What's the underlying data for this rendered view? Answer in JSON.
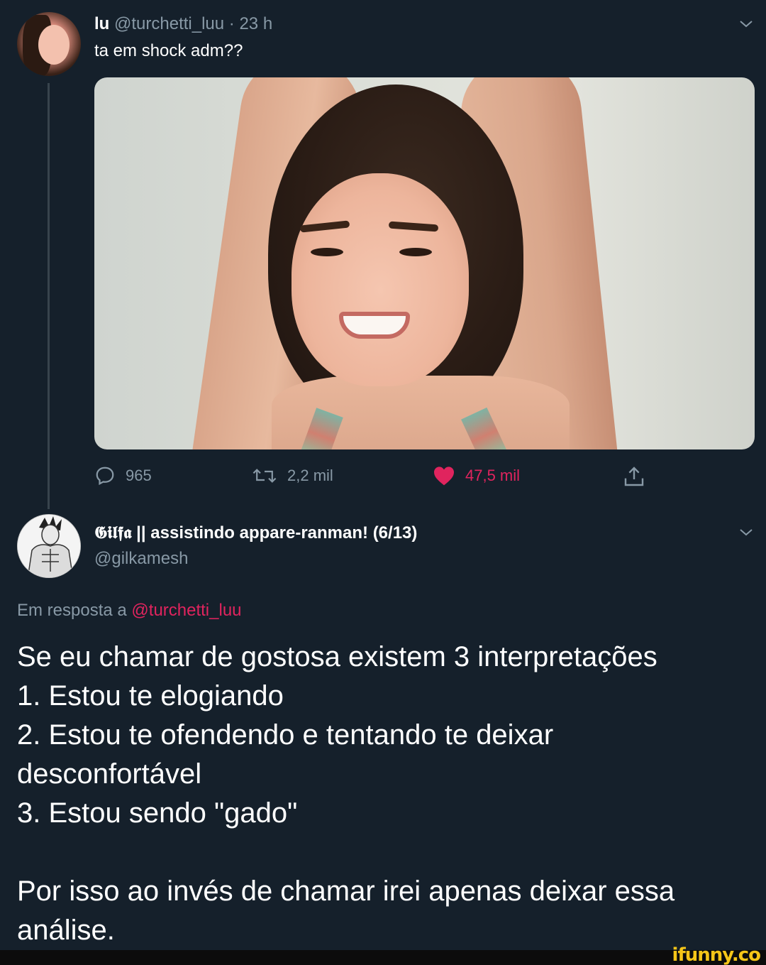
{
  "tweet1": {
    "name": "lu",
    "handle": "@turchetti_luu",
    "separator": "·",
    "time": "23 h",
    "text": "ta em shock adm??",
    "actions": {
      "replies": "965",
      "retweets": "2,2 mil",
      "likes": "47,5 mil"
    }
  },
  "tweet2": {
    "name_prefix": "𝕲𝖎𝖑𝖋𝖆",
    "name_rest": "|| assistindo appare-ranman! (6/13)",
    "handle": "@gilkamesh",
    "reply_label": "Em resposta a",
    "reply_to": "@turchetti_luu",
    "lines": [
      "Se eu chamar de gostosa existem 3 interpretações",
      "1. Estou te elogiando",
      "2. Estou te ofendendo e tentando te deixar",
      "desconfortável",
      "3. Estou sendo \"gado\""
    ],
    "closing": [
      "Por isso ao invés de chamar irei apenas deixar essa",
      "análise."
    ]
  },
  "watermark": "ifunny.co",
  "colors": {
    "background": "#15202b",
    "muted": "#8899a6",
    "like": "#e0245e",
    "watermark": "#f5c518"
  },
  "icons": {
    "reply": "speech-bubble-icon",
    "retweet": "retweet-icon",
    "like": "heart-icon",
    "share": "share-icon",
    "menu": "chevron-down-icon"
  }
}
